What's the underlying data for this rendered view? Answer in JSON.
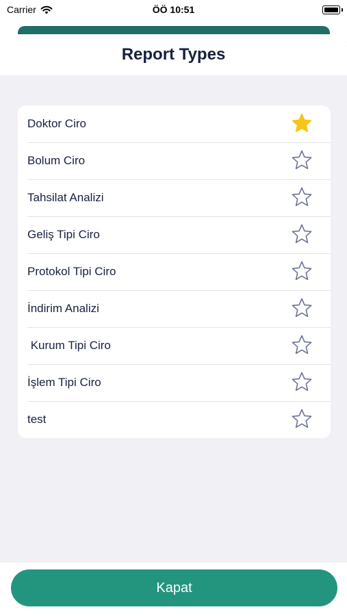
{
  "status_bar": {
    "carrier": "Carrier",
    "time": "ÖÖ 10:51"
  },
  "sheet": {
    "title": "Report Types"
  },
  "report_types": [
    {
      "label": "Doktor Ciro",
      "favorite": true
    },
    {
      "label": "Bolum Ciro",
      "favorite": false
    },
    {
      "label": "Tahsilat Analizi",
      "favorite": false
    },
    {
      "label": "Geliş Tipi Ciro",
      "favorite": false
    },
    {
      "label": "Protokol Tipi Ciro",
      "favorite": false
    },
    {
      "label": "İndirim Analizi",
      "favorite": false
    },
    {
      "label": " Kurum Tipi Ciro",
      "favorite": false
    },
    {
      "label": "İşlem Tipi Ciro",
      "favorite": false
    },
    {
      "label": "test",
      "favorite": false
    }
  ],
  "footer": {
    "close_label": "Kapat"
  },
  "colors": {
    "accent": "#23957f",
    "star_filled": "#f5c518",
    "star_outline": "#6b7394",
    "title": "#16213e"
  },
  "icons": {
    "favorite_on": "star-filled-icon",
    "favorite_off": "star-outline-icon"
  }
}
